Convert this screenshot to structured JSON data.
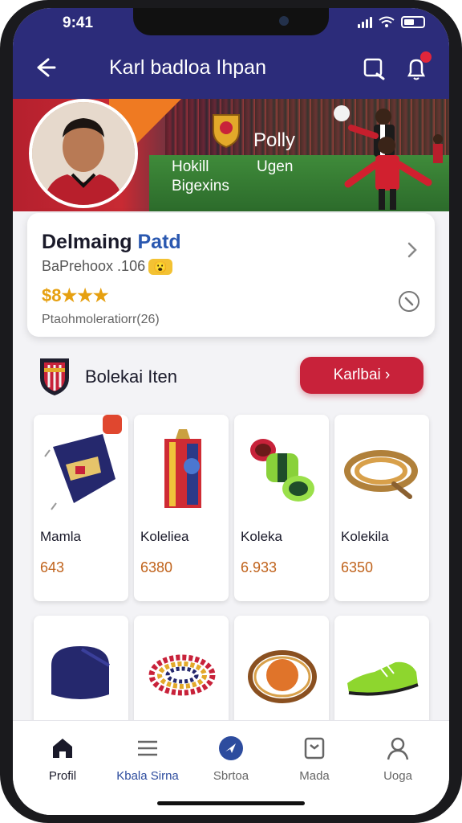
{
  "status_bar": {
    "time": "9:41"
  },
  "header": {
    "title": "Karl badloa Ihpan",
    "back_icon": "back-arrow-icon",
    "notification_count": ""
  },
  "hero": {
    "label_1": "Hokill",
    "label_2": "Bigexins",
    "label_3": "Ugen",
    "label_4": "Polly"
  },
  "profile": {
    "name_part1": "Delmaing ",
    "name_part2": "Patd",
    "subtitle": "BaPrehoox .106",
    "rating": "$8★★★",
    "stat": "Ptaohmoleratiorr(26)"
  },
  "section": {
    "title": "Bolekai Iten",
    "button_label": "Karlbai"
  },
  "items": [
    {
      "label": "Mamla",
      "price": "643",
      "icon": "scarf-icon"
    },
    {
      "label": "Koleliea",
      "price": "6380",
      "icon": "banner-icon"
    },
    {
      "label": "Koleka",
      "price": "6.933",
      "icon": "wristband-icon"
    },
    {
      "label": "Kolekila",
      "price": "6350",
      "icon": "rope-icon"
    },
    {
      "label": "",
      "price": "",
      "icon": "cap-icon"
    },
    {
      "label": "",
      "price": "",
      "icon": "bracelet-icon"
    },
    {
      "label": "",
      "price": "",
      "icon": "ball-ring-icon"
    },
    {
      "label": "",
      "price": "",
      "icon": "boot-icon"
    }
  ],
  "nav": [
    {
      "label": "Profil",
      "icon": "home-icon"
    },
    {
      "label": "Kbala Sirna",
      "icon": "list-icon"
    },
    {
      "label": "Sbrtoa",
      "icon": "compass-icon"
    },
    {
      "label": "Mada",
      "icon": "book-icon"
    },
    {
      "label": "Uoga",
      "icon": "user-icon"
    }
  ],
  "colors": {
    "header": "#2c2c7a",
    "accent_red": "#c8223a",
    "price": "#c0631c",
    "rating": "#e6a010"
  }
}
